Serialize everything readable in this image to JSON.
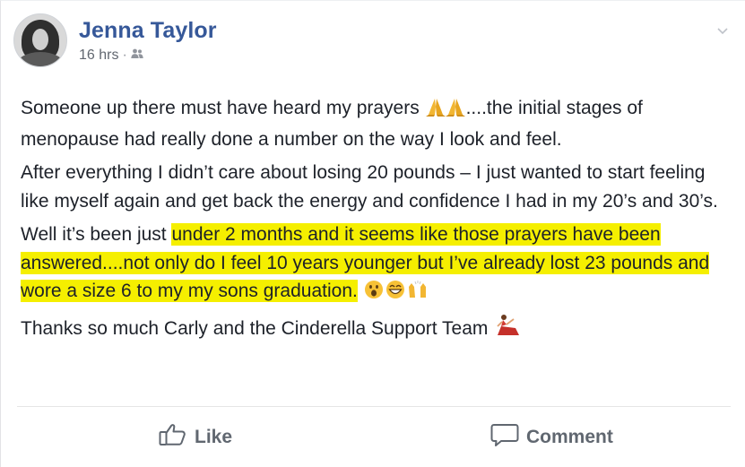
{
  "post": {
    "author": "Jenna Taylor",
    "timestamp": "16 hrs",
    "separator": "·",
    "audience_icon": "friends-icon",
    "menu_icon": "chevron-down-icon"
  },
  "content": {
    "p1_text": "Someone up there must have heard my prayers ",
    "p1_emoji": "folded-hands-icon",
    "p1_tail": "....the initial stages of menopause had really done a number on the way I look and feel.",
    "p2": "After everything I didn’t care about losing 20 pounds – I just wanted to start feeling like myself again and get back the energy and confidence I had in my 20’s and 30’s.",
    "p3_plain": "Well it’s been just ",
    "p3_highlight": "under 2 months and it seems like those prayers have been answered....not only do I feel 10 years younger but I’ve already lost 23 pounds and wore a size 6 to my my sons graduation.",
    "p3_emoji": "surprised-grin-praise-icons",
    "p4": "Thanks so much Carly and the Cinderella Support Team ",
    "p4_emoji": "dancer-icon"
  },
  "actions": {
    "like_label": "Like",
    "comment_label": "Comment"
  },
  "colors": {
    "name": "#365899",
    "text": "#1d2129",
    "muted": "#616770",
    "highlight": "#f5ef00",
    "action": "#606770"
  }
}
